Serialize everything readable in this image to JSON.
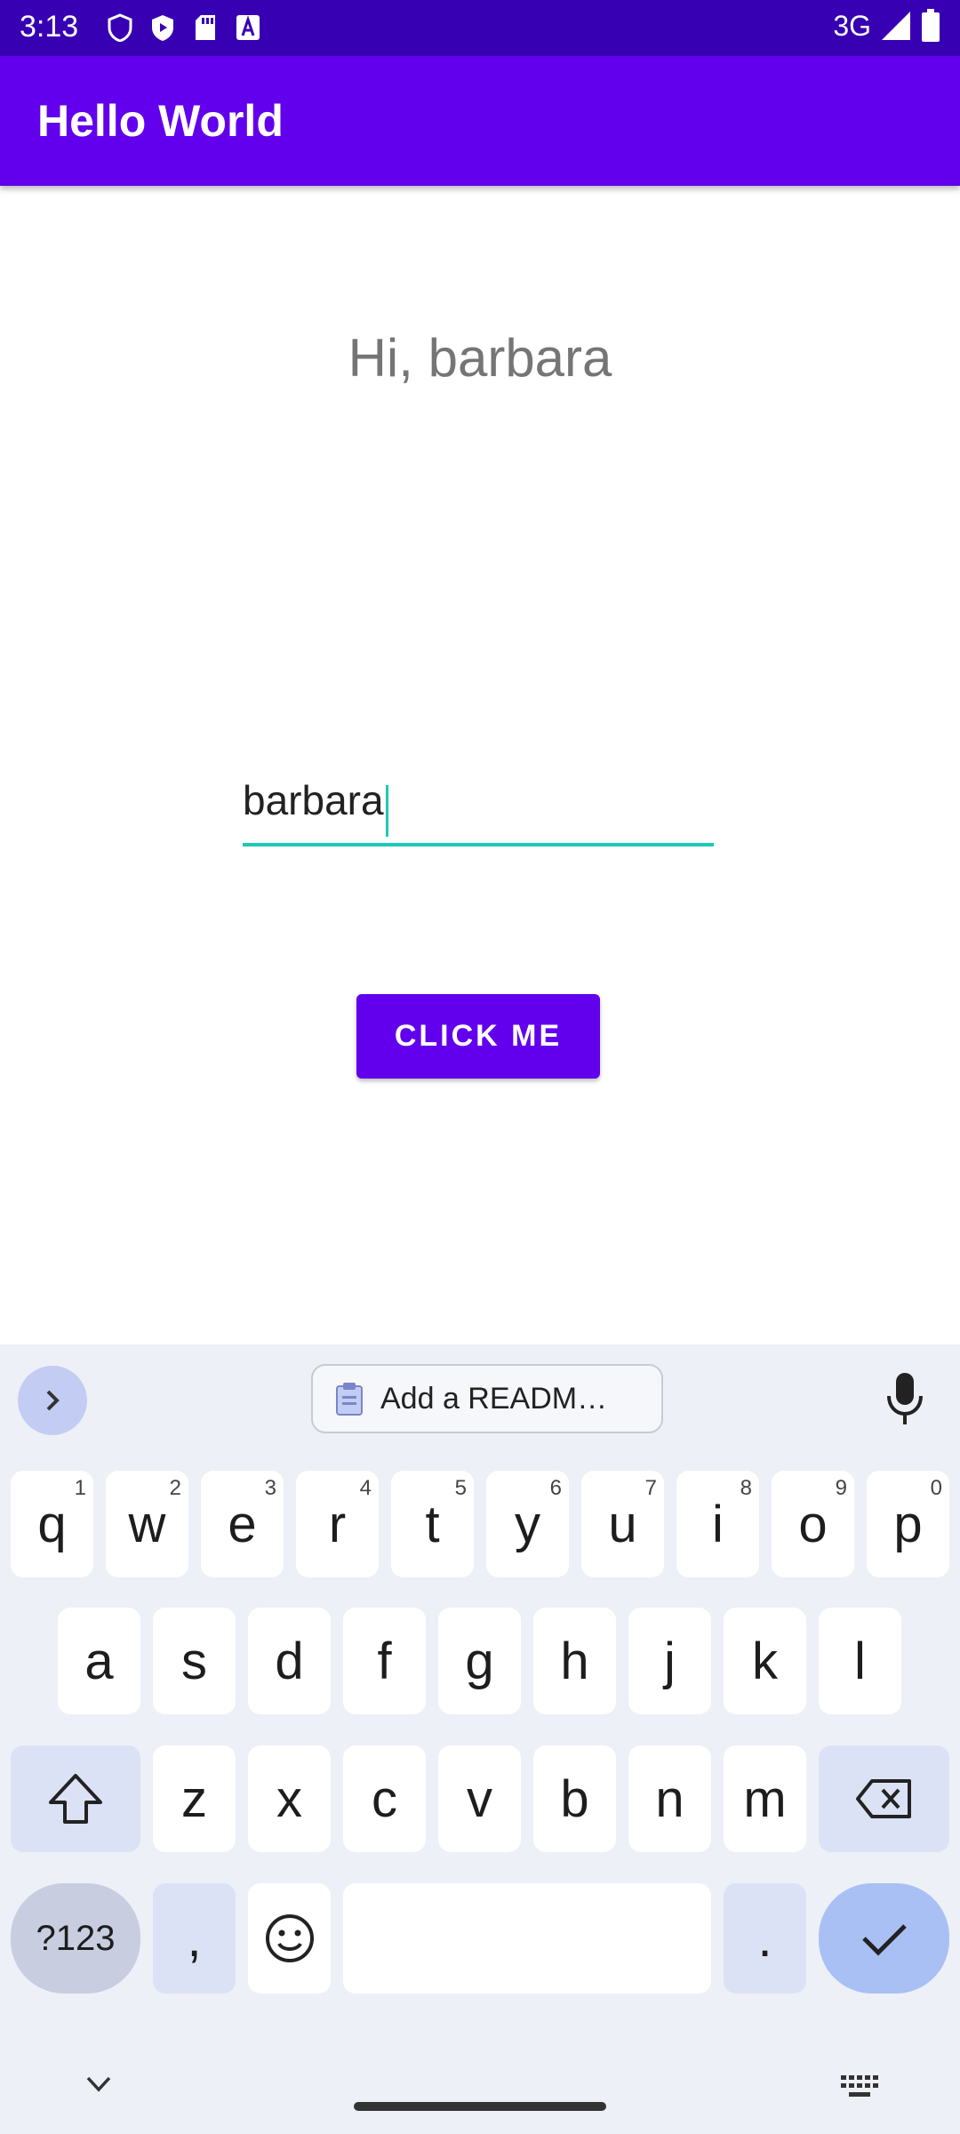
{
  "status_bar": {
    "time": "3:13",
    "network": "3G"
  },
  "app_bar": {
    "title": "Hello World"
  },
  "main": {
    "greeting": "Hi, barbara",
    "name_input": {
      "value": "barbara"
    },
    "button_label": "CLICK ME"
  },
  "keyboard": {
    "suggestion": "Add a READM…",
    "row1": [
      {
        "key": "q",
        "hint": "1"
      },
      {
        "key": "w",
        "hint": "2"
      },
      {
        "key": "e",
        "hint": "3"
      },
      {
        "key": "r",
        "hint": "4"
      },
      {
        "key": "t",
        "hint": "5"
      },
      {
        "key": "y",
        "hint": "6"
      },
      {
        "key": "u",
        "hint": "7"
      },
      {
        "key": "i",
        "hint": "8"
      },
      {
        "key": "o",
        "hint": "9"
      },
      {
        "key": "p",
        "hint": "0"
      }
    ],
    "row2": [
      "a",
      "s",
      "d",
      "f",
      "g",
      "h",
      "j",
      "k",
      "l"
    ],
    "row3": [
      "z",
      "x",
      "c",
      "v",
      "b",
      "n",
      "m"
    ],
    "symbols_label": "?123",
    "comma": ",",
    "period": "."
  },
  "colors": {
    "status_bar": "#3700b3",
    "app_bar": "#6200ee",
    "input_underline": "#1ec8b5",
    "keyboard_bg": "#eef0f7"
  }
}
